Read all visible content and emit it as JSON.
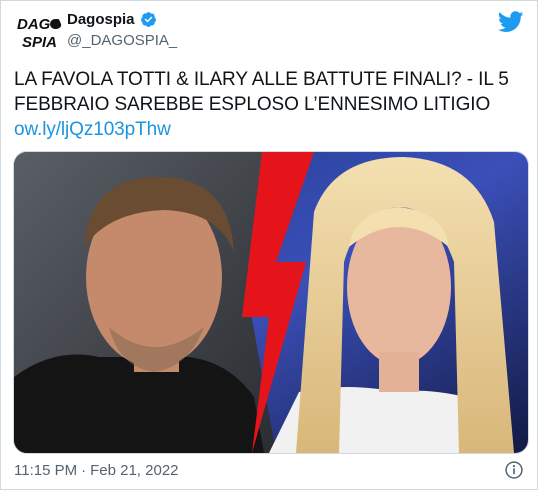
{
  "account": {
    "name": "Dagospia",
    "handle": "@_DAGOSPIA_",
    "avatar_text_top": "DAGO",
    "avatar_text_bottom": "SPIA"
  },
  "tweet": {
    "text": "LA FAVOLA TOTTI & ILARY ALLE BATTUTE FINALI? - IL 5 FEBBRAIO SAREBBE ESPLOSO L’ENNESIMO LITIGIO",
    "link": "ow.ly/ljQz103pThw"
  },
  "meta": {
    "time": "11:15 PM",
    "separator": "·",
    "date": "Feb 21, 2022"
  },
  "icons": {
    "verified": "verified-badge-icon",
    "twitter": "twitter-bird-icon",
    "info": "info-icon"
  },
  "colors": {
    "brand_blue": "#1d9bf0",
    "link_blue": "#1b95e0",
    "lightning_red": "#e5141a"
  }
}
